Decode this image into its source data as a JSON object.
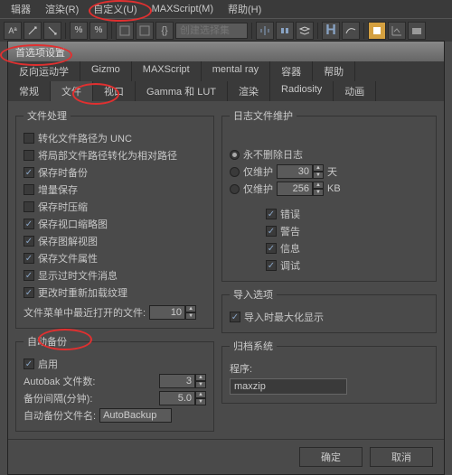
{
  "menu": {
    "editor": "辑器",
    "render": "渲染(R)",
    "customize": "自定义(U)",
    "maxscript": "MAXScript(M)",
    "help": "帮助(H)"
  },
  "toolbar": {
    "selset_placeholder": "创建选择集"
  },
  "dialog": {
    "title": "首选项设置",
    "tabs_r1": [
      "反向运动学",
      "Gizmo",
      "MAXScript",
      "mental ray",
      "容器",
      "帮助"
    ],
    "tabs_r2": [
      "常规",
      "文件",
      "视口",
      "Gamma 和 LUT",
      "渲染",
      "Radiosity",
      "动画"
    ],
    "ok": "确定",
    "cancel": "取消"
  },
  "fh": {
    "legend": "文件处理",
    "convert_unc": "转化文件路径为 UNC",
    "convert_rel": "将局部文件路径转化为相对路径",
    "backup": "保存时备份",
    "increment": "增量保存",
    "compress": "保存时压缩",
    "vp_thumb": "保存视口缩略图",
    "schematic": "保存图解视图",
    "props": "保存文件属性",
    "obsolete": "显示过时文件消息",
    "reload_tex": "更改时重新加载纹理",
    "recent_label": "文件菜单中最近打开的文件:",
    "recent_val": "10"
  },
  "ab": {
    "legend": "自动备份",
    "enable": "启用",
    "num_label": "Autobak 文件数:",
    "num_val": "3",
    "interval_label": "备份间隔(分钟):",
    "interval_val": "5.0",
    "name_label": "自动备份文件名:",
    "name_val": "AutoBackup"
  },
  "log": {
    "legend": "日志文件维护",
    "never": "永不删除日志",
    "days": "仅维护",
    "days_val": "30",
    "days_unit": "天",
    "kb": "仅维护",
    "kb_val": "256",
    "kb_unit": "KB",
    "err": "错误",
    "warn": "警告",
    "info": "信息",
    "debug": "调试"
  },
  "imp": {
    "legend": "导入选项",
    "zoom": "导入时最大化显示"
  },
  "arc": {
    "legend": "归档系统",
    "prog": "程序:",
    "val": "maxzip"
  }
}
